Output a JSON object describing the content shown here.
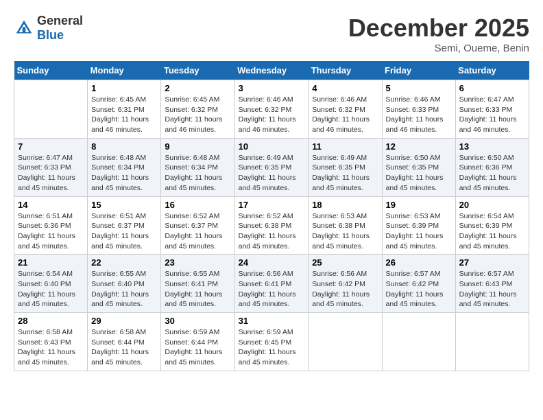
{
  "header": {
    "logo_general": "General",
    "logo_blue": "Blue",
    "title": "December 2025",
    "location": "Semi, Oueme, Benin"
  },
  "calendar": {
    "columns": [
      "Sunday",
      "Monday",
      "Tuesday",
      "Wednesday",
      "Thursday",
      "Friday",
      "Saturday"
    ],
    "weeks": [
      [
        {
          "day": "",
          "sunrise": "",
          "sunset": "",
          "daylight": ""
        },
        {
          "day": "1",
          "sunrise": "Sunrise: 6:45 AM",
          "sunset": "Sunset: 6:31 PM",
          "daylight": "Daylight: 11 hours and 46 minutes."
        },
        {
          "day": "2",
          "sunrise": "Sunrise: 6:45 AM",
          "sunset": "Sunset: 6:32 PM",
          "daylight": "Daylight: 11 hours and 46 minutes."
        },
        {
          "day": "3",
          "sunrise": "Sunrise: 6:46 AM",
          "sunset": "Sunset: 6:32 PM",
          "daylight": "Daylight: 11 hours and 46 minutes."
        },
        {
          "day": "4",
          "sunrise": "Sunrise: 6:46 AM",
          "sunset": "Sunset: 6:32 PM",
          "daylight": "Daylight: 11 hours and 46 minutes."
        },
        {
          "day": "5",
          "sunrise": "Sunrise: 6:46 AM",
          "sunset": "Sunset: 6:33 PM",
          "daylight": "Daylight: 11 hours and 46 minutes."
        },
        {
          "day": "6",
          "sunrise": "Sunrise: 6:47 AM",
          "sunset": "Sunset: 6:33 PM",
          "daylight": "Daylight: 11 hours and 46 minutes."
        }
      ],
      [
        {
          "day": "7",
          "sunrise": "Sunrise: 6:47 AM",
          "sunset": "Sunset: 6:33 PM",
          "daylight": "Daylight: 11 hours and 45 minutes."
        },
        {
          "day": "8",
          "sunrise": "Sunrise: 6:48 AM",
          "sunset": "Sunset: 6:34 PM",
          "daylight": "Daylight: 11 hours and 45 minutes."
        },
        {
          "day": "9",
          "sunrise": "Sunrise: 6:48 AM",
          "sunset": "Sunset: 6:34 PM",
          "daylight": "Daylight: 11 hours and 45 minutes."
        },
        {
          "day": "10",
          "sunrise": "Sunrise: 6:49 AM",
          "sunset": "Sunset: 6:35 PM",
          "daylight": "Daylight: 11 hours and 45 minutes."
        },
        {
          "day": "11",
          "sunrise": "Sunrise: 6:49 AM",
          "sunset": "Sunset: 6:35 PM",
          "daylight": "Daylight: 11 hours and 45 minutes."
        },
        {
          "day": "12",
          "sunrise": "Sunrise: 6:50 AM",
          "sunset": "Sunset: 6:35 PM",
          "daylight": "Daylight: 11 hours and 45 minutes."
        },
        {
          "day": "13",
          "sunrise": "Sunrise: 6:50 AM",
          "sunset": "Sunset: 6:36 PM",
          "daylight": "Daylight: 11 hours and 45 minutes."
        }
      ],
      [
        {
          "day": "14",
          "sunrise": "Sunrise: 6:51 AM",
          "sunset": "Sunset: 6:36 PM",
          "daylight": "Daylight: 11 hours and 45 minutes."
        },
        {
          "day": "15",
          "sunrise": "Sunrise: 6:51 AM",
          "sunset": "Sunset: 6:37 PM",
          "daylight": "Daylight: 11 hours and 45 minutes."
        },
        {
          "day": "16",
          "sunrise": "Sunrise: 6:52 AM",
          "sunset": "Sunset: 6:37 PM",
          "daylight": "Daylight: 11 hours and 45 minutes."
        },
        {
          "day": "17",
          "sunrise": "Sunrise: 6:52 AM",
          "sunset": "Sunset: 6:38 PM",
          "daylight": "Daylight: 11 hours and 45 minutes."
        },
        {
          "day": "18",
          "sunrise": "Sunrise: 6:53 AM",
          "sunset": "Sunset: 6:38 PM",
          "daylight": "Daylight: 11 hours and 45 minutes."
        },
        {
          "day": "19",
          "sunrise": "Sunrise: 6:53 AM",
          "sunset": "Sunset: 6:39 PM",
          "daylight": "Daylight: 11 hours and 45 minutes."
        },
        {
          "day": "20",
          "sunrise": "Sunrise: 6:54 AM",
          "sunset": "Sunset: 6:39 PM",
          "daylight": "Daylight: 11 hours and 45 minutes."
        }
      ],
      [
        {
          "day": "21",
          "sunrise": "Sunrise: 6:54 AM",
          "sunset": "Sunset: 6:40 PM",
          "daylight": "Daylight: 11 hours and 45 minutes."
        },
        {
          "day": "22",
          "sunrise": "Sunrise: 6:55 AM",
          "sunset": "Sunset: 6:40 PM",
          "daylight": "Daylight: 11 hours and 45 minutes."
        },
        {
          "day": "23",
          "sunrise": "Sunrise: 6:55 AM",
          "sunset": "Sunset: 6:41 PM",
          "daylight": "Daylight: 11 hours and 45 minutes."
        },
        {
          "day": "24",
          "sunrise": "Sunrise: 6:56 AM",
          "sunset": "Sunset: 6:41 PM",
          "daylight": "Daylight: 11 hours and 45 minutes."
        },
        {
          "day": "25",
          "sunrise": "Sunrise: 6:56 AM",
          "sunset": "Sunset: 6:42 PM",
          "daylight": "Daylight: 11 hours and 45 minutes."
        },
        {
          "day": "26",
          "sunrise": "Sunrise: 6:57 AM",
          "sunset": "Sunset: 6:42 PM",
          "daylight": "Daylight: 11 hours and 45 minutes."
        },
        {
          "day": "27",
          "sunrise": "Sunrise: 6:57 AM",
          "sunset": "Sunset: 6:43 PM",
          "daylight": "Daylight: 11 hours and 45 minutes."
        }
      ],
      [
        {
          "day": "28",
          "sunrise": "Sunrise: 6:58 AM",
          "sunset": "Sunset: 6:43 PM",
          "daylight": "Daylight: 11 hours and 45 minutes."
        },
        {
          "day": "29",
          "sunrise": "Sunrise: 6:58 AM",
          "sunset": "Sunset: 6:44 PM",
          "daylight": "Daylight: 11 hours and 45 minutes."
        },
        {
          "day": "30",
          "sunrise": "Sunrise: 6:59 AM",
          "sunset": "Sunset: 6:44 PM",
          "daylight": "Daylight: 11 hours and 45 minutes."
        },
        {
          "day": "31",
          "sunrise": "Sunrise: 6:59 AM",
          "sunset": "Sunset: 6:45 PM",
          "daylight": "Daylight: 11 hours and 45 minutes."
        },
        {
          "day": "",
          "sunrise": "",
          "sunset": "",
          "daylight": ""
        },
        {
          "day": "",
          "sunrise": "",
          "sunset": "",
          "daylight": ""
        },
        {
          "day": "",
          "sunrise": "",
          "sunset": "",
          "daylight": ""
        }
      ]
    ]
  }
}
